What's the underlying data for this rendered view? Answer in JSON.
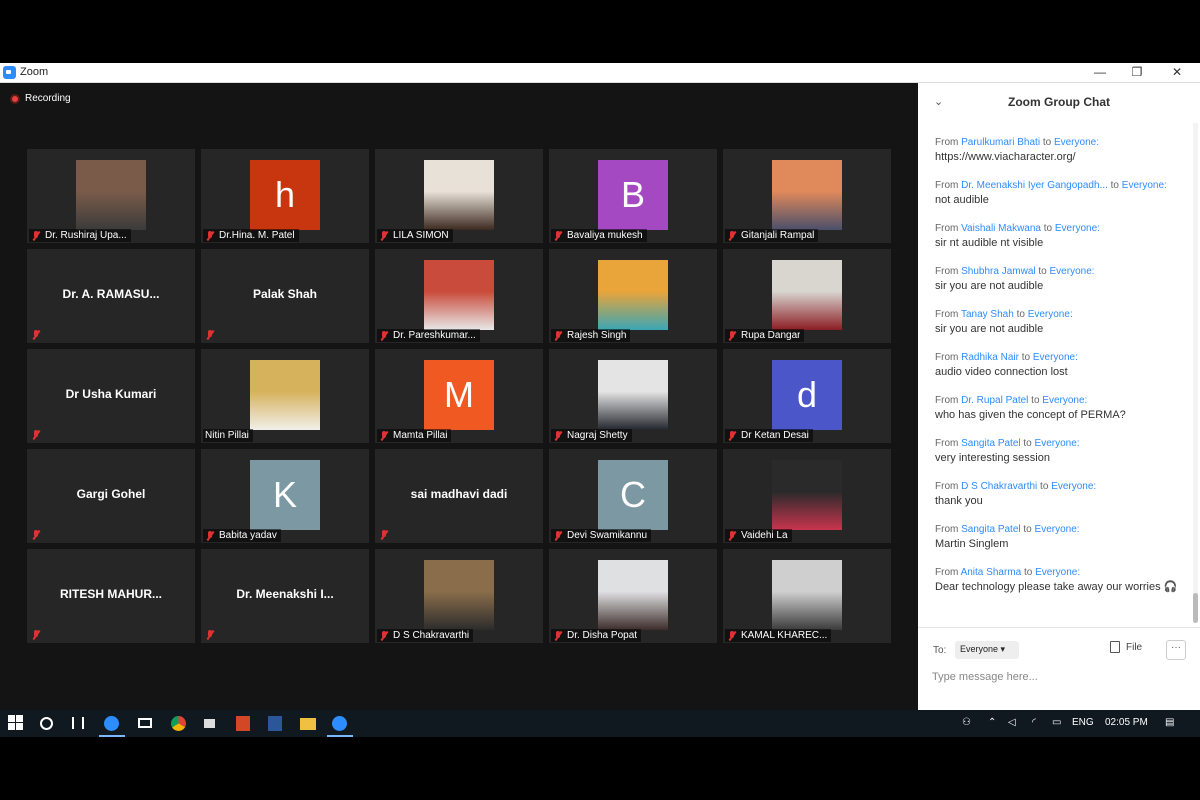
{
  "window": {
    "title": "Zoom",
    "minimize": "—",
    "maximize": "❐",
    "close": "✕"
  },
  "recording_label": "Recording",
  "tiles": [
    {
      "name": "Dr. Rushiraj Upa...",
      "kind": "photo",
      "colors": [
        "#7a5b4a",
        "#3b3b3b"
      ],
      "muted": true
    },
    {
      "name": "Dr.Hina. M. Patel",
      "kind": "letter",
      "letter": "h",
      "bg": "#c7360f",
      "muted": true
    },
    {
      "name": "LILA SIMON",
      "kind": "photo",
      "colors": [
        "#e8e1d8",
        "#3d2a20"
      ],
      "muted": true
    },
    {
      "name": "Bavaliya mukesh",
      "kind": "letter",
      "letter": "B",
      "bg": "#a549c2",
      "muted": true
    },
    {
      "name": "Gitanjali Rampal",
      "kind": "photo",
      "colors": [
        "#e0895a",
        "#4a4f6a"
      ],
      "muted": true
    },
    {
      "name": "Dr. A. RAMASU...",
      "kind": "text",
      "muted": true
    },
    {
      "name": "Palak Shah",
      "kind": "text",
      "muted": true
    },
    {
      "name": "Dr. Pareshkumar...",
      "kind": "photo",
      "colors": [
        "#c94b3b",
        "#e8e8e8"
      ],
      "muted": true
    },
    {
      "name": "Rajesh Singh",
      "kind": "photo",
      "colors": [
        "#e9a43a",
        "#3aa6b5"
      ],
      "muted": true
    },
    {
      "name": "Rupa Dangar",
      "kind": "photo",
      "colors": [
        "#d9d5cf",
        "#8a1d24"
      ],
      "muted": true
    },
    {
      "name": "Dr Usha Kumari",
      "kind": "text",
      "muted": true
    },
    {
      "name": "Nitin Pillai",
      "kind": "photo",
      "colors": [
        "#d6b25d",
        "#f1efe9"
      ],
      "muted": false
    },
    {
      "name": "Mamta Pillai",
      "kind": "letter",
      "letter": "M",
      "bg": "#f05a22",
      "muted": true
    },
    {
      "name": "Nagraj Shetty",
      "kind": "photo",
      "colors": [
        "#e4e4e4",
        "#23262d"
      ],
      "muted": true
    },
    {
      "name": "Dr Ketan Desai",
      "kind": "letter",
      "letter": "d",
      "bg": "#4b56c8",
      "muted": true
    },
    {
      "name": "Gargi Gohel",
      "kind": "text",
      "muted": true
    },
    {
      "name": "Babita yadav",
      "kind": "letter",
      "letter": "K",
      "bg": "#7c98a2",
      "muted": true
    },
    {
      "name": "sai madhavi dadi",
      "kind": "text",
      "muted": true
    },
    {
      "name": "Devi Swamikannu",
      "kind": "letter",
      "letter": "C",
      "bg": "#7c98a2",
      "muted": true
    },
    {
      "name": "Vaidehi La",
      "kind": "photo",
      "colors": [
        "#2a2a2a",
        "#c9344e"
      ],
      "muted": true
    },
    {
      "name": "RITESH MAHUR...",
      "kind": "text",
      "muted": true
    },
    {
      "name": "Dr. Meenakshi I...",
      "kind": "text",
      "muted": true
    },
    {
      "name": "D S Chakravarthi",
      "kind": "photo",
      "colors": [
        "#8a6d4b",
        "#2c2c2c"
      ],
      "muted": true
    },
    {
      "name": "Dr. Disha Popat",
      "kind": "photo",
      "colors": [
        "#dfe0e2",
        "#3c2d2b"
      ],
      "muted": true
    },
    {
      "name": "KAMAL KHAREC...",
      "kind": "photo",
      "colors": [
        "#cfcfcf",
        "#3b3b3b"
      ],
      "muted": true
    }
  ],
  "chat": {
    "title": "Zoom Group Chat",
    "collapse_icon": "⌄",
    "messages": [
      {
        "from": "Parulkumari Bhati",
        "to": "Everyone",
        "text": "https://www.viacharacter.org/"
      },
      {
        "from": "Dr. Meenakshi Iyer Gangopadh...",
        "to": "Everyone",
        "text": "not audible"
      },
      {
        "from": "Vaishali Makwana",
        "to": "Everyone",
        "text": "sir nt audible nt visible"
      },
      {
        "from": "Shubhra Jamwal",
        "to": "Everyone",
        "text": "sir you are not audible"
      },
      {
        "from": "Tanay Shah",
        "to": "Everyone",
        "text": "sir you are not audible"
      },
      {
        "from": "Radhika Nair",
        "to": "Everyone",
        "text": "audio video connection lost"
      },
      {
        "from": "Dr. Rupal Patel",
        "to": "Everyone",
        "text": "who has given the concept of PERMA?"
      },
      {
        "from": "Sangita Patel",
        "to": "Everyone",
        "text": "very interesting session"
      },
      {
        "from": "D S Chakravarthi",
        "to": "Everyone",
        "text": "thank you"
      },
      {
        "from": "Sangita Patel",
        "to": "Everyone",
        "text": "Martin Singlem"
      },
      {
        "from": "Anita Sharma",
        "to": "Everyone",
        "text": "Dear technology  please take away our worries 🎧"
      }
    ],
    "from_word": "From",
    "to_word": "to",
    "to_label": "To:",
    "to_value": "Everyone ▾",
    "file_label": "File",
    "more_label": "···",
    "input_placeholder": "Type message here..."
  },
  "taskbar": {
    "language": "ENG",
    "time": "02:05 PM"
  }
}
